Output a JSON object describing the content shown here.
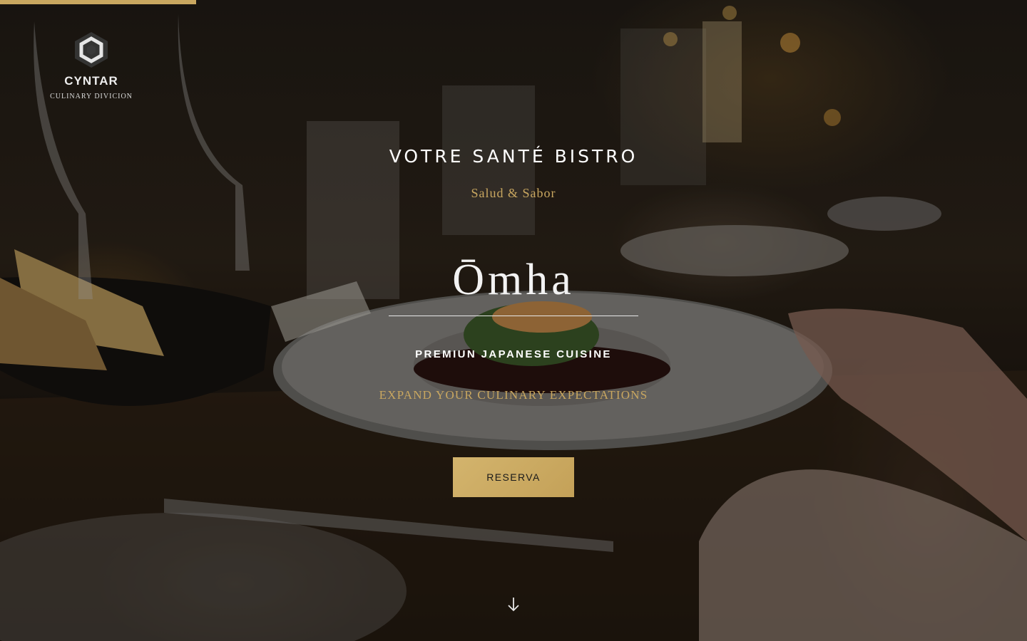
{
  "logo": {
    "name": "CYNTAR",
    "subtitle": "CULINARY DIVICION"
  },
  "hero": {
    "title": "VOTRE SANTÉ BISTRO",
    "tagline": "Salud & Sabor",
    "brand": "Ōmha",
    "cuisine": "PREMIUN JAPANESE CUISINE",
    "slogan": "EXPAND YOUR CULINARY EXPECTATIONS",
    "cta_label": "RESERVA"
  },
  "icons": {
    "logo": "hexagon-logo-icon",
    "scroll": "arrow-down-icon"
  },
  "colors": {
    "accent_gold": "#c9a760",
    "text_white": "#ffffff",
    "button_text": "#1a1a1a"
  }
}
